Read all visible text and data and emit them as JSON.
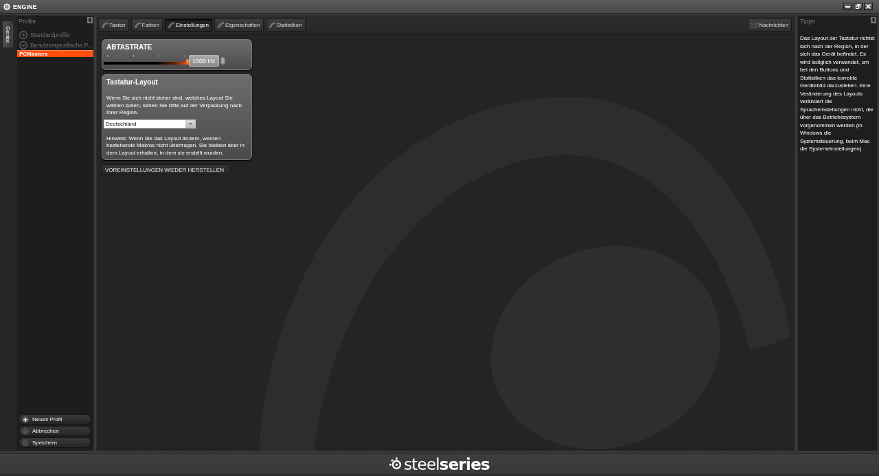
{
  "window": {
    "title": "ENGINE"
  },
  "side_tabs": [
    {
      "label": "Geräte",
      "selected": true
    }
  ],
  "profiles": {
    "title": "Profile",
    "items": [
      {
        "label": "Standardprofile",
        "expanded": false,
        "selected": false
      },
      {
        "label": "Benutzerspezifische P...",
        "expanded": true,
        "selected": false,
        "children": [
          {
            "label": "PCMasters",
            "selected": true
          }
        ]
      }
    ],
    "buttons": [
      {
        "label": "Neues Profil",
        "kind": "add"
      },
      {
        "label": "Abbrechen",
        "kind": "plain"
      },
      {
        "label": "Speichern",
        "kind": "plain"
      }
    ]
  },
  "tabs": [
    {
      "label": "Tasten",
      "selected": false
    },
    {
      "label": "Farben",
      "selected": false
    },
    {
      "label": "Einstellungen",
      "selected": true
    },
    {
      "label": "Eigenschaften",
      "selected": false
    },
    {
      "label": "Statistiken",
      "selected": false
    }
  ],
  "messages_button": {
    "label": "Nachrichten"
  },
  "sample_rate": {
    "title": "ABTASTRATE",
    "level": 1,
    "value": "1000 Hz"
  },
  "layout": {
    "title": "Tastatur-Layout",
    "description": "Wenn Sie sich nicht sicher sind, welches Layout Sie wählen sollen, sehen Sie bitte auf der Verpackung nach Ihrer Region.",
    "value": "Deutschland",
    "note": "Hinweis: Wenn Sie das Layout ändern, werden bestehende Makros nicht übertragen. Sie bleiben aber in dem Layout erhalten, in dem sie erstellt wurden."
  },
  "reset_button": {
    "label": "VOREINSTELLUNGEN WIEDER HERSTELLEN"
  },
  "tips": {
    "title": "Tipps",
    "text": "Das Layout der Tastatur richtet sich nach der Region, in der sich das Gerät befindet. Es wird lediglich verwendet, um bei den Buttons und Statistiken das korrekte Gerätebild darzustellen. Eine Veränderung des Layouts verändert die Spracheinstellungen nicht, die über das Betriebssystem vorgenommen werden (in Windows die Systemsteuerung, beim Mac die Systemeinstellungen)."
  },
  "footer": {
    "logo": "steel**series**"
  }
}
